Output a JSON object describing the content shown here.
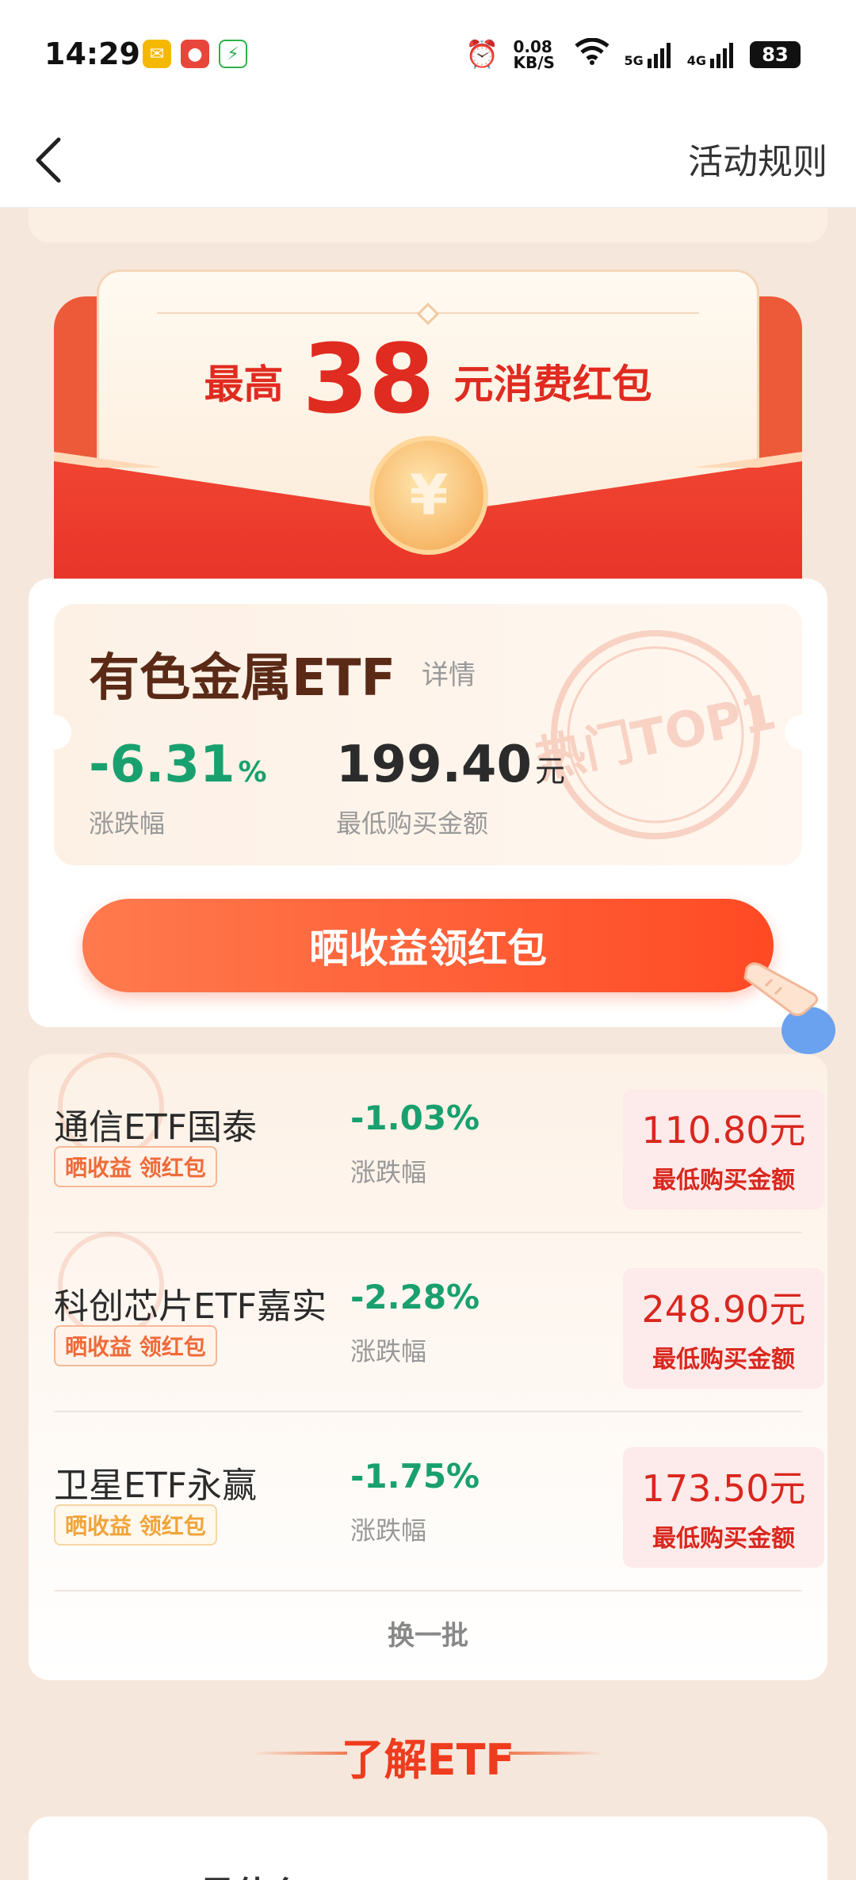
{
  "status_bar": {
    "time": "14:29",
    "net_speed": "0.08 KB/S",
    "signal_1": "5G",
    "signal_2": "4G",
    "battery": "83"
  },
  "nav": {
    "rules_label": "活动规则"
  },
  "envelope": {
    "prefix": "最高",
    "amount": "38",
    "suffix": "元消费红包",
    "coin_symbol": "¥"
  },
  "hot_etf": {
    "name": "有色金属ETF",
    "detail_label": "详情",
    "change_value": "-6.31",
    "change_pct": "%",
    "change_label": "涨跌幅",
    "price_value": "199.40",
    "price_unit": "元",
    "price_label": "最低购买金额",
    "stamp_text": "热门TOP1",
    "cta_label": "晒收益领红包"
  },
  "etf_list": [
    {
      "name": "通信ETF国泰",
      "tag": "晒收益 领红包",
      "change": "-1.03%",
      "change_label": "涨跌幅",
      "price": "110.80元",
      "price_label": "最低购买金额"
    },
    {
      "name": "科创芯片ETF嘉实",
      "tag": "晒收益 领红包",
      "change": "-2.28%",
      "change_label": "涨跌幅",
      "price": "248.90元",
      "price_label": "最低购买金额"
    },
    {
      "name": "卫星ETF永赢",
      "tag": "晒收益 领红包",
      "change": "-1.75%",
      "change_label": "涨跌幅",
      "price": "173.50元",
      "price_label": "最低购买金额"
    }
  ],
  "refresh_label": "换一批",
  "section_title": "了解ETF",
  "bottom_card_title": "ETF是什么",
  "colors": {
    "accent_red": "#e02b20",
    "down_green": "#19a06f",
    "button_orange": "#ff5a30"
  }
}
